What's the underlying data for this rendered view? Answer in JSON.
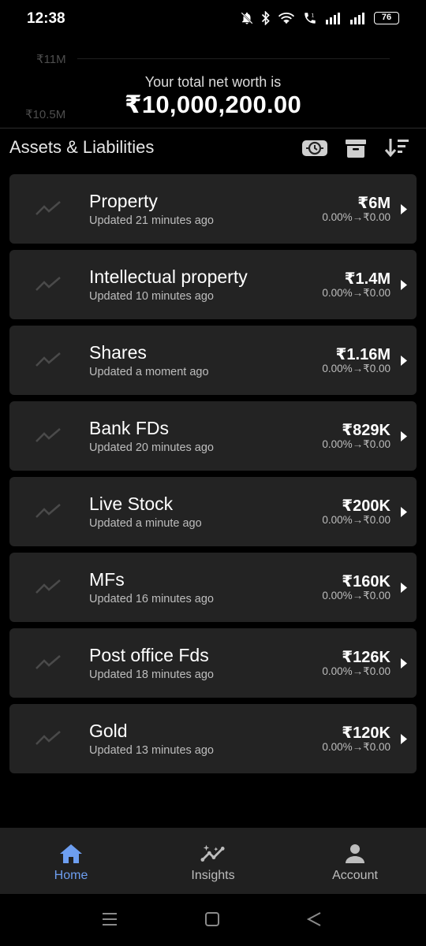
{
  "status_bar": {
    "time": "12:38",
    "battery": "76",
    "icons": [
      "bell-off-icon",
      "bluetooth-icon",
      "wifi-icon",
      "call-icon",
      "signal-icon",
      "signal-icon",
      "battery-icon"
    ]
  },
  "header": {
    "bg_tick_top": "₹11M",
    "bg_tick_bottom": "₹10.5M",
    "net_worth_label": "Your total net worth is",
    "net_worth_value": "₹10,000,200.00"
  },
  "section": {
    "title": "Assets & Liabilities",
    "actions": [
      "history-icon",
      "archive-icon",
      "sort-icon"
    ]
  },
  "assets": [
    {
      "name": "Property",
      "updated": "Updated 21 minutes ago",
      "value": "₹6M",
      "change": "0.00%→₹0.00"
    },
    {
      "name": "Intellectual property",
      "updated": "Updated 10 minutes ago",
      "value": "₹1.4M",
      "change": "0.00%→₹0.00"
    },
    {
      "name": "Shares",
      "updated": "Updated a moment ago",
      "value": "₹1.16M",
      "change": "0.00%→₹0.00"
    },
    {
      "name": "Bank FDs",
      "updated": "Updated 20 minutes ago",
      "value": "₹829K",
      "change": "0.00%→₹0.00"
    },
    {
      "name": "Live Stock",
      "updated": "Updated a minute ago",
      "value": "₹200K",
      "change": "0.00%→₹0.00"
    },
    {
      "name": "MFs",
      "updated": "Updated 16 minutes ago",
      "value": "₹160K",
      "change": "0.00%→₹0.00"
    },
    {
      "name": "Post office Fds",
      "updated": "Updated 18 minutes ago",
      "value": "₹126K",
      "change": "0.00%→₹0.00"
    },
    {
      "name": "Gold",
      "updated": "Updated 13 minutes ago",
      "value": "₹120K",
      "change": "0.00%→₹0.00"
    }
  ],
  "nav": {
    "items": [
      {
        "label": "Home",
        "icon": "home-icon",
        "active": true
      },
      {
        "label": "Insights",
        "icon": "insights-icon",
        "active": false
      },
      {
        "label": "Account",
        "icon": "account-icon",
        "active": false
      }
    ]
  },
  "colors": {
    "background": "#000000",
    "card": "#232323",
    "accent": "#6d9ef0",
    "nav_bg": "#202020"
  }
}
